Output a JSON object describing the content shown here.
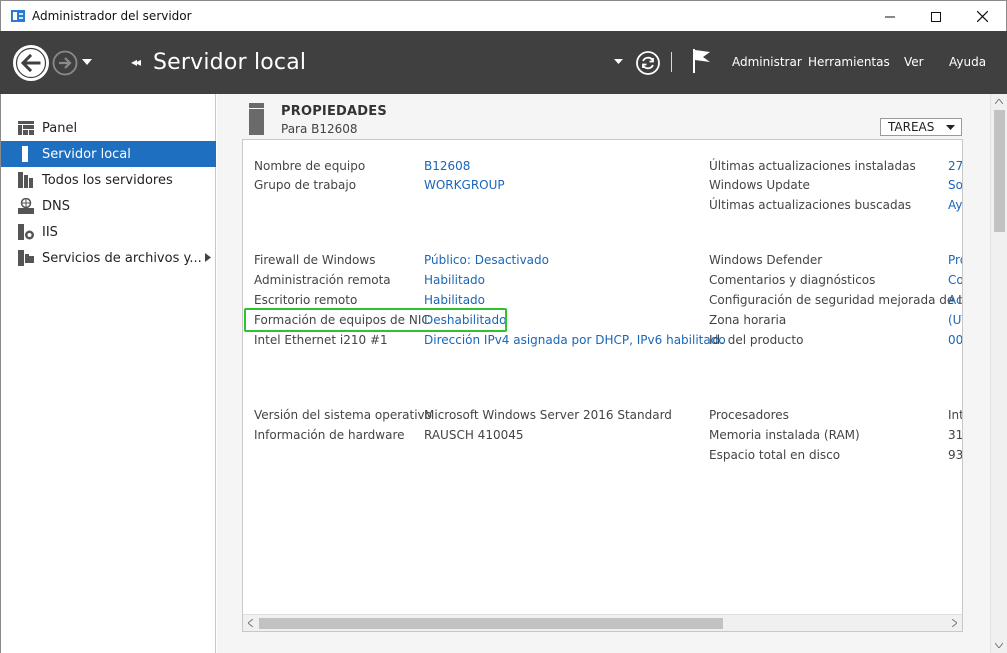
{
  "window": {
    "title": "Administrador del servidor"
  },
  "header": {
    "title": "Servidor local",
    "menu": [
      "Administrar",
      "Herramientas",
      "Ver",
      "Ayuda"
    ]
  },
  "sidebar": {
    "items": [
      {
        "label": "Panel",
        "icon": "dashboard-icon"
      },
      {
        "label": "Servidor local",
        "icon": "server-icon",
        "active": true
      },
      {
        "label": "Todos los servidores",
        "icon": "servers-icon"
      },
      {
        "label": "DNS",
        "icon": "dns-icon"
      },
      {
        "label": "IIS",
        "icon": "iis-icon"
      },
      {
        "label": "Servicios de archivos y...",
        "icon": "file-services-icon",
        "expandable": true
      }
    ]
  },
  "properties": {
    "title": "PROPIEDADES",
    "subtitle": "Para B12608",
    "tasks_label": "TAREAS",
    "left": [
      {
        "label": "Nombre de equipo",
        "value": "B12608",
        "link": true
      },
      {
        "label": "Grupo de trabajo",
        "value": "WORKGROUP",
        "link": true
      },
      {
        "label": "Firewall de Windows",
        "value": "Público: Desactivado",
        "link": true
      },
      {
        "label": "Administración remota",
        "value": "Habilitado",
        "link": true
      },
      {
        "label": "Escritorio remoto",
        "value": "Habilitado",
        "link": true
      },
      {
        "label": "Formación de equipos de NIC",
        "value": "Deshabilitado",
        "link": true
      },
      {
        "label": "Intel Ethernet i210 #1",
        "value": "Dirección IPv4 asignada por DHCP, IPv6 habilitado",
        "link": true
      },
      {
        "label": "Versión del sistema operativo",
        "value": "Microsoft Windows Server 2016 Standard",
        "link": false
      },
      {
        "label": "Información de hardware",
        "value": "RAUSCH 410045",
        "link": false
      }
    ],
    "right": [
      {
        "label": "Últimas actualizaciones instaladas",
        "value": "27",
        "link": true
      },
      {
        "label": "Windows Update",
        "value": "So",
        "link": true
      },
      {
        "label": "Últimas actualizaciones buscadas",
        "value": "Ay",
        "link": true
      },
      {
        "label": "Windows Defender",
        "value": "Pro",
        "link": true
      },
      {
        "label": "Comentarios y diagnósticos",
        "value": "Co",
        "link": true
      },
      {
        "label": "Configuración de seguridad mejorada de IE",
        "value": "Ac",
        "link": true
      },
      {
        "label": "Zona horaria",
        "value": "(UT",
        "link": true
      },
      {
        "label": "Id. del producto",
        "value": "00",
        "link": true
      },
      {
        "label": "Procesadores",
        "value": "Int",
        "link": false
      },
      {
        "label": "Memoria instalada (RAM)",
        "value": "31",
        "link": false
      },
      {
        "label": "Espacio total en disco",
        "value": "93",
        "link": false
      }
    ]
  },
  "colors": {
    "header_bg": "#404040",
    "accent": "#1e6fbf",
    "link": "#1a66b8",
    "highlight": "#2fc22f"
  }
}
